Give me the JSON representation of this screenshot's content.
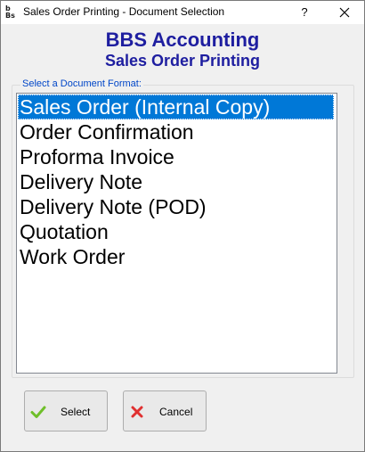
{
  "window": {
    "title": "Sales Order Printing - Document Selection",
    "help_label": "?"
  },
  "header": {
    "app_name": "BBS Accounting",
    "subtitle": "Sales Order Printing"
  },
  "document_format": {
    "label": "Select a Document Format:",
    "items": [
      {
        "label": "Sales Order (Internal Copy)",
        "selected": true
      },
      {
        "label": "Order Confirmation",
        "selected": false
      },
      {
        "label": "Proforma Invoice",
        "selected": false
      },
      {
        "label": "Delivery Note",
        "selected": false
      },
      {
        "label": "Delivery Note (POD)",
        "selected": false
      },
      {
        "label": "Quotation",
        "selected": false
      },
      {
        "label": "Work Order",
        "selected": false
      }
    ]
  },
  "buttons": {
    "select_label": "Select",
    "cancel_label": "Cancel"
  },
  "colors": {
    "heading": "#1e1ea0",
    "group_label": "#0046c8",
    "selection": "#0078d7",
    "select_icon": "#6fbf2a",
    "cancel_icon": "#e03030"
  },
  "icons": {
    "app": "bbs-app-icon",
    "select": "check-icon",
    "cancel": "cross-icon",
    "close": "close-icon"
  }
}
